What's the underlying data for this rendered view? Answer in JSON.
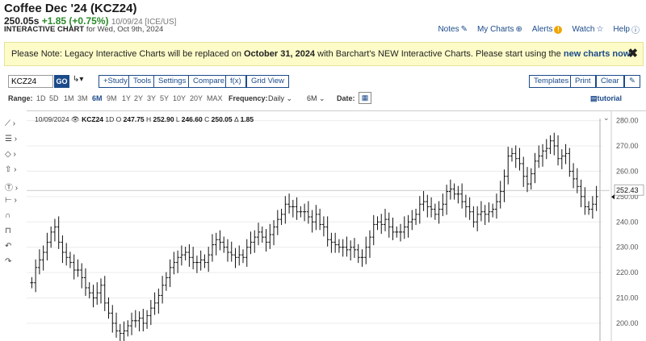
{
  "header": {
    "title": "Coffee Dec '24 (KCZ24)",
    "price": "250.05s",
    "change": "+1.85 (+0.75%)",
    "timestamp": "10/09/24 [ICE/US]",
    "subtitle_bold": "INTERACTIVE CHART",
    "subtitle_rest": "for Wed, Oct 9th, 2024"
  },
  "links": {
    "notes": "Notes",
    "my_charts": "My Charts",
    "alerts": "Alerts",
    "watch": "Watch",
    "help": "Help"
  },
  "notice": {
    "text1": "Please Note: Legacy Interactive Charts will be replaced on",
    "date": "October 31, 2024",
    "text2": "with Barchart's NEW Interactive Charts. Please start using the",
    "link": "new charts now",
    "close": "✖"
  },
  "toolbar": {
    "symbol_value": "KCZ24",
    "go": "GO",
    "draw": "↳▾",
    "study": "+Study",
    "tools": "Tools",
    "settings": "Settings",
    "compare": "Compare",
    "fx": "f(x)",
    "grid_view": "Grid View",
    "templates": "Templates",
    "print": "Print",
    "clear": "Clear",
    "pen": "✎"
  },
  "range": {
    "label": "Range:",
    "options": [
      "1D",
      "5D",
      "1M",
      "3M",
      "6M",
      "9M",
      "1Y",
      "2Y",
      "3Y",
      "5Y",
      "10Y",
      "20Y",
      "MAX"
    ],
    "selected": "6M",
    "frequency_label": "Frequency:",
    "frequency": "Daily",
    "period": "6M",
    "date_label": "Date:",
    "tutorial": "tutorial"
  },
  "legend": {
    "date": "10/09/2024",
    "symbol": "KCZ24",
    "interval": "1D",
    "o_label": "O",
    "o": "247.75",
    "h_label": "H",
    "h": "252.90",
    "l_label": "L",
    "l": "246.60",
    "c_label": "C",
    "c": "250.05",
    "d_label": "Δ",
    "d": "1.85"
  },
  "chart_data": {
    "type": "ohlc",
    "ylim": [
      193,
      284
    ],
    "yticks": [
      200,
      210,
      220,
      230,
      240,
      250,
      260,
      270,
      280
    ],
    "ytick_labels": [
      "200.00",
      "210.00",
      "220.00",
      "230.00",
      "240.00",
      "250.00",
      "260.00",
      "270.00",
      "280.00"
    ],
    "last_price_label": "252.43",
    "last_price_value": 252.43,
    "close_series": [
      216,
      222,
      225,
      228,
      232,
      236,
      238,
      232,
      228,
      226,
      224,
      221,
      221,
      218,
      214,
      212,
      210,
      212,
      215,
      208,
      204,
      200,
      197,
      196,
      197,
      199,
      201,
      201,
      202,
      200,
      203,
      206,
      208,
      211,
      215,
      218,
      222,
      224,
      226,
      227,
      228,
      226,
      224,
      224,
      225,
      224,
      227,
      231,
      233,
      232,
      230,
      228,
      227,
      226,
      227,
      226,
      230,
      232,
      234,
      236,
      234,
      232,
      235,
      238,
      241,
      243,
      247,
      246,
      246,
      244,
      244,
      244,
      242,
      240,
      243,
      239,
      238,
      233,
      232,
      231,
      230,
      230,
      229,
      230,
      229,
      226,
      226,
      230,
      234,
      239,
      240,
      239,
      241,
      238,
      236,
      236,
      236,
      238,
      240,
      241,
      243,
      247,
      248,
      246,
      245,
      243,
      245,
      247,
      252,
      253,
      251,
      251,
      248,
      246,
      244,
      240,
      243,
      244,
      243,
      244,
      245,
      248,
      252,
      258,
      266,
      267,
      265,
      263,
      258,
      255,
      259,
      264,
      266,
      268,
      269,
      272,
      270,
      265,
      266,
      267,
      260,
      257,
      254,
      250,
      246,
      245,
      247,
      250
    ]
  }
}
